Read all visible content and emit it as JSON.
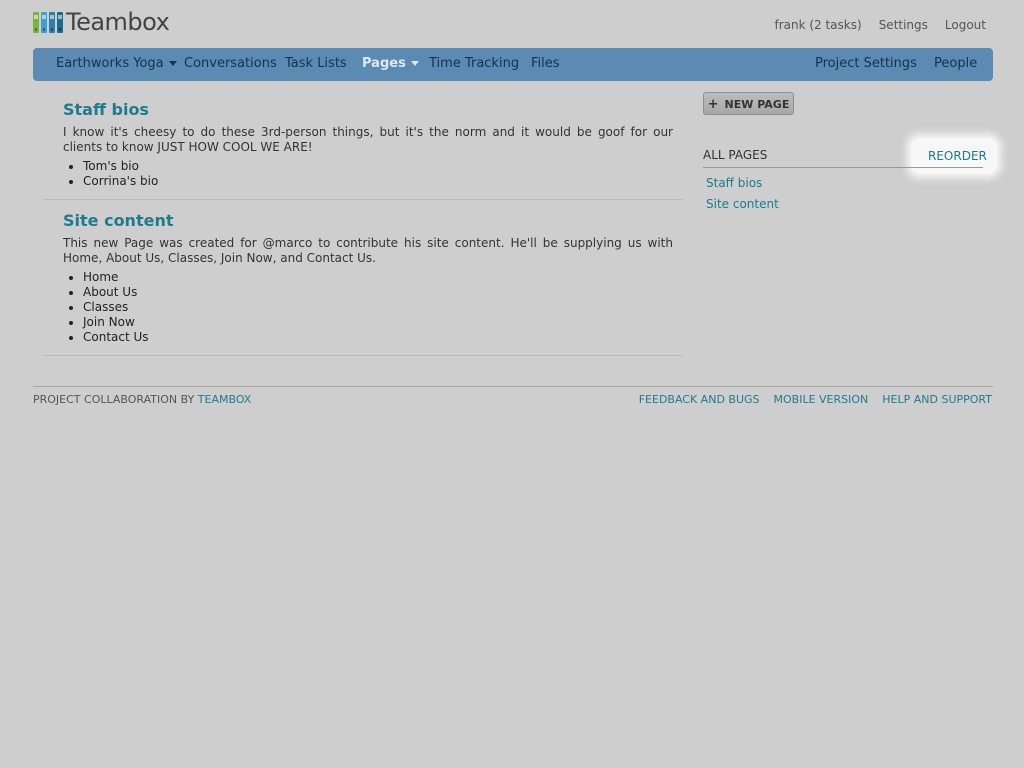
{
  "app": {
    "name": "Teambox",
    "logo_colors": [
      "#7fb23a",
      "#3f9fcf",
      "#2c7fae",
      "#1d6b8a"
    ]
  },
  "header": {
    "user_tasks": "frank (2 tasks)",
    "settings": "Settings",
    "logout": "Logout"
  },
  "nav": {
    "project": "Earthworks Yoga",
    "conversations": "Conversations",
    "task_lists": "Task Lists",
    "pages": "Pages",
    "time_tracking": "Time Tracking",
    "files": "Files",
    "project_settings": "Project Settings",
    "people": "People"
  },
  "pages": [
    {
      "title": "Staff bios",
      "description": "I know it's cheesy to do these 3rd-person things, but it's the norm and it would be goof for our clients to know JUST HOW COOL WE ARE!",
      "items": [
        "Tom's bio",
        "Corrina's bio"
      ]
    },
    {
      "title": "Site content",
      "description": "This new Page was created for @marco to contribute his site content. He'll be supplying us with Home, About Us, Classes, Join Now, and Contact Us.",
      "items": [
        "Home",
        "About Us",
        "Classes",
        "Join Now",
        "Contact Us"
      ]
    }
  ],
  "sidebar": {
    "new_page_label": "NEW PAGE",
    "new_page_icon": "+",
    "all_pages_label": "ALL PAGES",
    "reorder_label": "REORDER",
    "links": [
      "Staff bios",
      "Site content"
    ]
  },
  "footer": {
    "prefix": "PROJECT COLLABORATION BY",
    "brand_link": "TEAMBOX",
    "feedback": "FEEDBACK AND BUGS",
    "mobile": "MOBILE VERSION",
    "help": "HELP AND SUPPORT"
  },
  "colors": {
    "background": "#cecece",
    "navbar": "#5b8ab3",
    "link": "#1e7b8e",
    "highlight": "#f7f7f7"
  }
}
